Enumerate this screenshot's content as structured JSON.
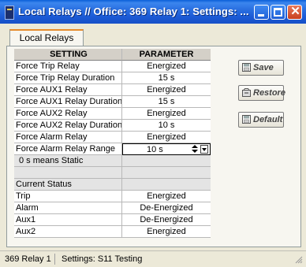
{
  "window": {
    "title": "Local Relays // Office: 369 Relay 1: Settings: ...",
    "minimize_icon": "minimize-icon",
    "maximize_icon": "maximize-icon",
    "close_icon": "close-icon"
  },
  "tab": {
    "label": "Local Relays"
  },
  "table": {
    "header_setting": "SETTING",
    "header_parameter": "PARAMETER",
    "rows": [
      {
        "setting": "Force Trip Relay",
        "parameter": "Energized"
      },
      {
        "setting": "Force Trip Relay Duration",
        "parameter": "15 s"
      },
      {
        "setting": "Force AUX1 Relay",
        "parameter": "Energized"
      },
      {
        "setting": "Force AUX1 Relay Duration",
        "parameter": "15 s"
      },
      {
        "setting": "Force AUX2 Relay",
        "parameter": "Energized"
      },
      {
        "setting": "Force AUX2 Relay Duration",
        "parameter": "10 s"
      },
      {
        "setting": "Force Alarm Relay",
        "parameter": "Energized"
      },
      {
        "setting": "Force Alarm Relay Range",
        "parameter": "10 s"
      }
    ],
    "note": "0 s means Static",
    "status_header": "Current Status",
    "status_rows": [
      {
        "setting": "Trip",
        "parameter": "Energized"
      },
      {
        "setting": "Alarm",
        "parameter": "De-Energized"
      },
      {
        "setting": "Aux1",
        "parameter": "De-Energized"
      },
      {
        "setting": "Aux2",
        "parameter": "Energized"
      }
    ]
  },
  "buttons": {
    "save": "Save",
    "restore": "Restore",
    "default": "Default"
  },
  "statusbar": {
    "device": "369 Relay 1",
    "settings": "Settings: S11 Testing"
  },
  "colors": {
    "titlebar": "#1c5bd6",
    "tab_accent": "#e68b2c",
    "close_button": "#c8401f"
  }
}
